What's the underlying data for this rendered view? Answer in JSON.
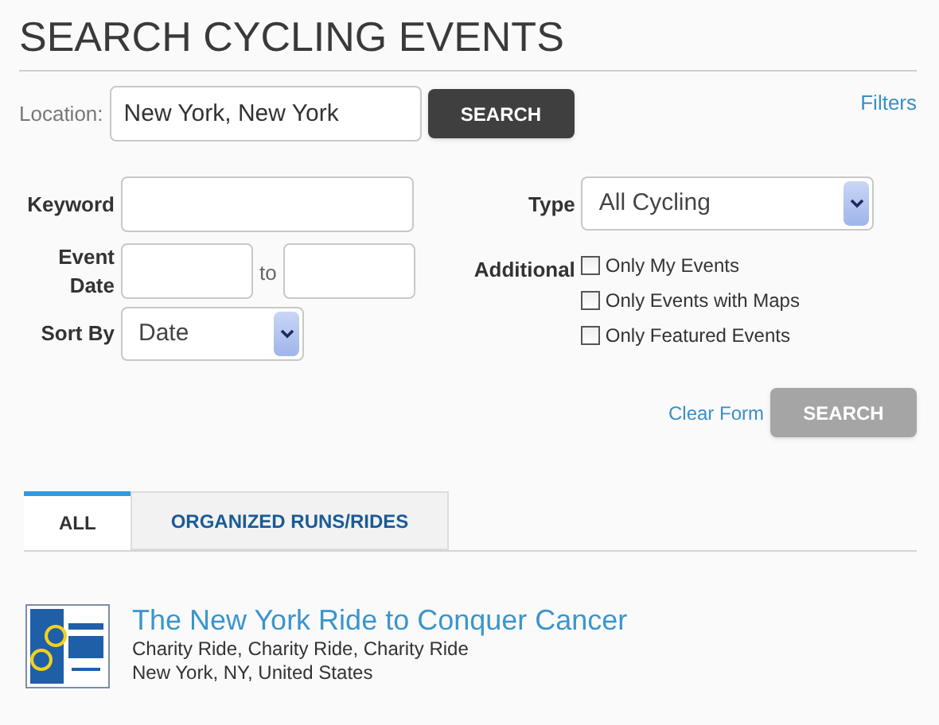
{
  "title": "SEARCH CYCLING EVENTS",
  "location": {
    "label": "Location:",
    "value": "New York, New York",
    "button": "SEARCH"
  },
  "filters_link": "Filters",
  "form": {
    "keyword": {
      "label": "Keyword"
    },
    "type": {
      "label": "Type",
      "value": "All Cycling"
    },
    "event_date": {
      "label": "Event Date",
      "separator": "to"
    },
    "additional": {
      "label": "Additional",
      "options": [
        {
          "label": "Only My Events",
          "checked": false
        },
        {
          "label": "Only Events with Maps",
          "checked": false
        },
        {
          "label": "Only Featured Events",
          "checked": false
        }
      ]
    },
    "sort_by": {
      "label": "Sort By",
      "value": "Date"
    },
    "clear": "Clear Form",
    "submit": "SEARCH"
  },
  "tabs": [
    {
      "label": "ALL",
      "selected": true
    },
    {
      "label": "ORGANIZED RUNS/RIDES",
      "selected": false
    }
  ],
  "results": [
    {
      "title": "The New York Ride to Conquer Cancer",
      "categories": "Charity Ride, Charity Ride, Charity Ride",
      "place": "New York, NY, United States"
    }
  ]
}
